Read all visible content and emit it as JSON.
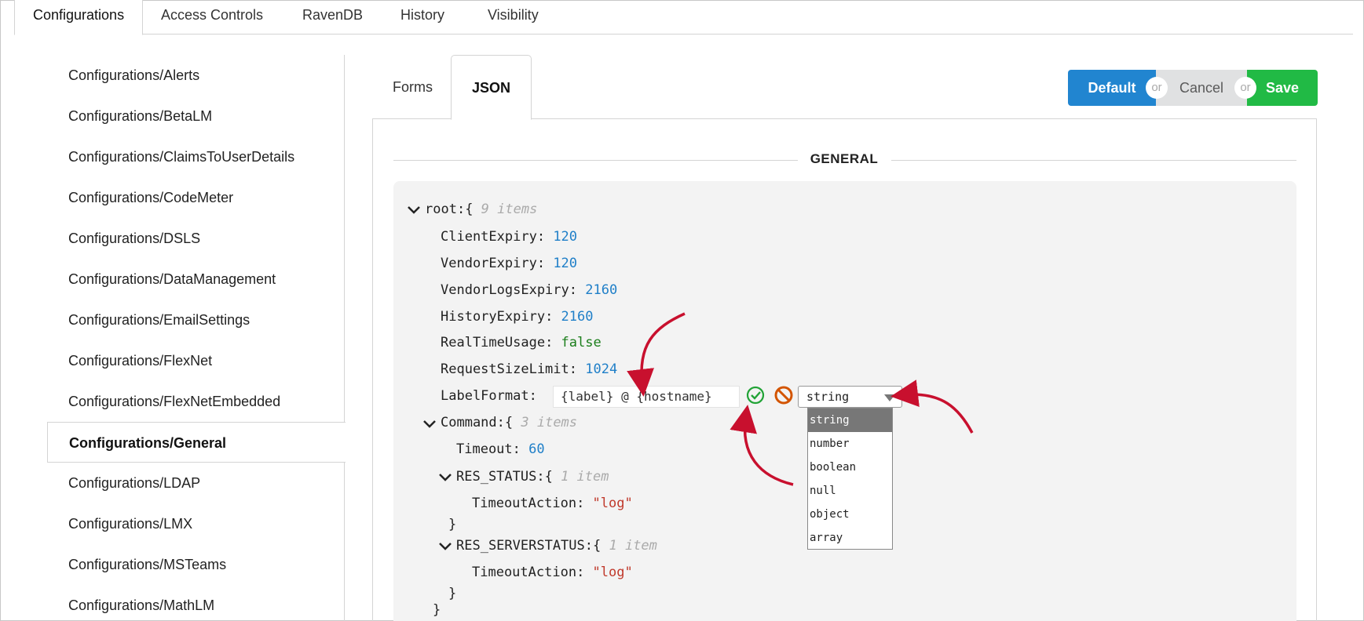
{
  "top_tabs": [
    {
      "label": "Configurations",
      "active": true
    },
    {
      "label": "Access Controls"
    },
    {
      "label": "RavenDB"
    },
    {
      "label": "History"
    },
    {
      "label": "Visibility"
    }
  ],
  "sidebar": {
    "items": [
      {
        "label": "Configurations/Alerts"
      },
      {
        "label": "Configurations/BetaLM"
      },
      {
        "label": "Configurations/ClaimsToUserDetails"
      },
      {
        "label": "Configurations/CodeMeter"
      },
      {
        "label": "Configurations/DSLS"
      },
      {
        "label": "Configurations/DataManagement"
      },
      {
        "label": "Configurations/EmailSettings"
      },
      {
        "label": "Configurations/FlexNet"
      },
      {
        "label": "Configurations/FlexNetEmbedded"
      },
      {
        "label": "Configurations/General",
        "active": true
      },
      {
        "label": "Configurations/LDAP"
      },
      {
        "label": "Configurations/LMX"
      },
      {
        "label": "Configurations/MSTeams"
      },
      {
        "label": "Configurations/MathLM"
      }
    ]
  },
  "inner_tabs": [
    {
      "label": "Forms"
    },
    {
      "label": "JSON",
      "active": true
    }
  ],
  "actions": {
    "default_label": "Default",
    "cancel_label": "Cancel",
    "save_label": "Save",
    "or_label": "or",
    "colors": {
      "default": "#2185d0",
      "cancel": "#e0e1e2",
      "save": "#21ba45"
    }
  },
  "section": {
    "title": "GENERAL"
  },
  "json_editor": {
    "root_key": "root",
    "root_count": "9 items",
    "fields": [
      {
        "key": "ClientExpiry",
        "value": "120",
        "type": "number"
      },
      {
        "key": "VendorExpiry",
        "value": "120",
        "type": "number"
      },
      {
        "key": "VendorLogsExpiry",
        "value": "2160",
        "type": "number"
      },
      {
        "key": "HistoryExpiry",
        "value": "2160",
        "type": "number"
      },
      {
        "key": "RealTimeUsage",
        "value": "false",
        "type": "boolean"
      },
      {
        "key": "RequestSizeLimit",
        "value": "1024",
        "type": "number"
      }
    ],
    "editing": {
      "key": "LabelFormat",
      "value": "{label} @ {hostname}",
      "selected_type": "string",
      "type_options": [
        "string",
        "number",
        "boolean",
        "null",
        "object",
        "array"
      ]
    },
    "command": {
      "key": "Command",
      "count": "3 items",
      "timeout_key": "Timeout",
      "timeout_value": "60",
      "res_status": {
        "key": "RES_STATUS",
        "count": "1 item",
        "action_key": "TimeoutAction",
        "action_value": "\"log\""
      },
      "res_serverstatus": {
        "key": "RES_SERVERSTATUS",
        "count": "1 item",
        "action_key": "TimeoutAction",
        "action_value": "\"log\""
      }
    },
    "colors": {
      "number": "#1f7fc8",
      "boolean": "#1a7d1a",
      "string": "#c0392b",
      "annotation_arrow": "#c8102e"
    }
  }
}
